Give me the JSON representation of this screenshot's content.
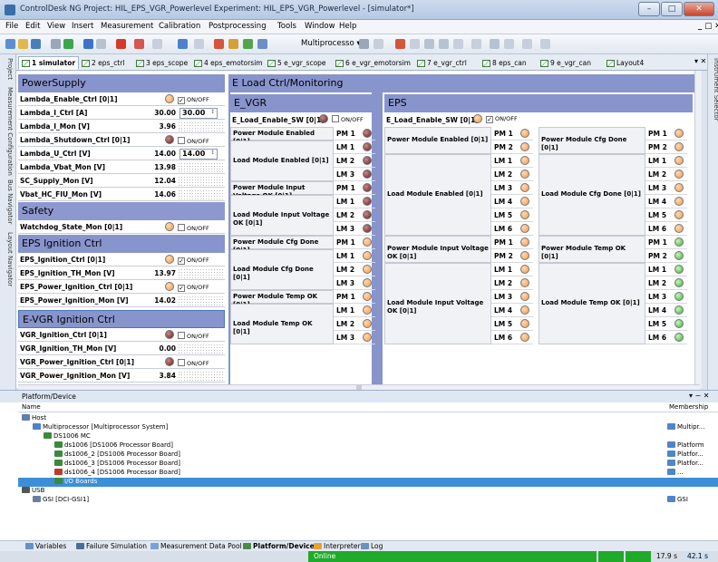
{
  "window": {
    "title": "ControlDesk NG  Project: HIL_EPS_VGR_Powerlevel  Experiment: HIL_EPS_VGR_Powerlevel - [simulator*]"
  },
  "menu": [
    "File",
    "Edit",
    "View",
    "Insert",
    "Measurement",
    "Calibration",
    "Postprocessing",
    "Tools",
    "Window",
    "Help"
  ],
  "toolbar": {
    "platform_dropdown": "Multiprocesso"
  },
  "tabs": [
    "1 simulator",
    "2 eps_ctrl",
    "3 eps_scope",
    "4 eps_emotorsim",
    "5 e_vgr_scope",
    "6 e_vgr_emotorsim",
    "7 e_vgr_ctrl",
    "8 eps_can",
    "9 e_vgr_can",
    "Layout4"
  ],
  "left_side_tabs": [
    "Project",
    "Measurement Configuration",
    "Bus Navigator",
    "Layout Navigator"
  ],
  "right_side_tabs": [
    "Instrument Selector"
  ],
  "powersupply": {
    "title": "PowerSupply",
    "rows": [
      {
        "label": "Lambda_Enable_Ctrl [0|1]",
        "lamp": "on",
        "check": "ON/OFF",
        "checked": "✓"
      },
      {
        "label": "Lambda_I_Ctrl [A]",
        "value": "30.00",
        "input": "30.00"
      },
      {
        "label": "Lambda_I_Mon [V]",
        "value": "3.96"
      },
      {
        "label": "Lambda_Shutdown_Ctrl [0|1]",
        "lamp": "off",
        "check": "ON/OFF",
        "checked": ""
      },
      {
        "label": "Lambda_U_Ctrl [V]",
        "value": "14.00",
        "input": "14.00"
      },
      {
        "label": "Lambda_Vbat_Mon [V]",
        "value": "13.98"
      },
      {
        "label": "SC_Supply_Mon [V]",
        "value": "12.04"
      },
      {
        "label": "Vbat_HC_FIU_Mon [V]",
        "value": "14.06"
      }
    ]
  },
  "safety": {
    "title": "Safety",
    "rows": [
      {
        "label": "Watchdog_State_Mon [0|1]",
        "lamp": "on",
        "check": "ON/OFF",
        "checked": ""
      }
    ]
  },
  "eps_ignition": {
    "title": "EPS Ignition Ctrl",
    "rows": [
      {
        "label": "EPS_Ignition_Ctrl [0|1]",
        "lamp": "on",
        "check": "ON/OFF",
        "checked": "✓"
      },
      {
        "label": "EPS_Ignition_TH_Mon [V]",
        "value": "13.97"
      },
      {
        "label": "EPS_Power_Ignition_Ctrl [0|1]",
        "lamp": "on",
        "check": "ON/OFF",
        "checked": "✓"
      },
      {
        "label": "EPS_Power_Ignition_Mon [V]",
        "value": "14.02"
      }
    ]
  },
  "evgr_ignition": {
    "title": "E-VGR Ignition Ctrl",
    "rows": [
      {
        "label": "VGR_Ignition_Ctrl [0|1]",
        "lamp": "off",
        "check": "ON/OFF",
        "checked": ""
      },
      {
        "label": "VGR_Ignition_TH_Mon [V]",
        "value": "0.00"
      },
      {
        "label": "VGR_Power_Ignition_Ctrl [0|1]",
        "lamp": "off",
        "check": "ON/OFF",
        "checked": ""
      },
      {
        "label": "VGR_Power_Ignition_Mon [V]",
        "value": "3.84"
      }
    ]
  },
  "eload": {
    "title": "E Load Ctrl/Monitoring"
  },
  "evgr": {
    "title": "E_VGR",
    "switch_label": "E_Load_Enable_SW [0|1]",
    "switch_check": "ON/OFF",
    "groups": [
      {
        "label": "Power Module Enabled [0|1]",
        "items": [
          "PM 1"
        ]
      },
      {
        "label": "Load Module Enabled [0|1]",
        "items": [
          "LM 1",
          "LM 2",
          "LM 3"
        ]
      },
      {
        "label": "Power Module Input Voltage OK [0|1]",
        "items": [
          "PM 1"
        ]
      },
      {
        "label": "Load Module Input Voltage OK [0|1]",
        "items": [
          "LM 1",
          "LM 2",
          "LM 3"
        ]
      },
      {
        "label": "Power Module Cfg Done [0|1]",
        "items": [
          "PM 1"
        ]
      },
      {
        "label": "Load Module Cfg Done [0|1]",
        "items": [
          "LM 1",
          "LM 2",
          "LM 3"
        ]
      },
      {
        "label": "Power Module Temp OK [0|1]",
        "items": [
          "PM 1"
        ]
      },
      {
        "label": "Load Module Temp OK [0|1]",
        "items": [
          "LM 1",
          "LM 2",
          "LM 3"
        ]
      }
    ]
  },
  "eps": {
    "title": "EPS",
    "switch_label": "E_Load_Enable_SW [0|1]",
    "switch_check": "ON/OFF",
    "groups_left": [
      {
        "label": "Power Module Enabled [0|1]",
        "items": [
          "PM 1",
          "PM 2"
        ]
      },
      {
        "label": "Load Module Enabled [0|1]",
        "items": [
          "LM 1",
          "LM 2",
          "LM 3",
          "LM 4",
          "LM 5",
          "LM 6"
        ]
      },
      {
        "label": "Power Module Input Voltage OK [0|1]",
        "items": [
          "PM 1",
          "PM 2"
        ]
      },
      {
        "label": "Load Module Input Voltage OK [0|1]",
        "items": [
          "LM 1",
          "LM 2",
          "LM 3",
          "LM 4",
          "LM 5",
          "LM 6"
        ]
      }
    ],
    "groups_right": [
      {
        "label": "Power Module Cfg Done [0|1]",
        "items": [
          "PM 1",
          "PM 2"
        ]
      },
      {
        "label": "Load Module Cfg Done [0|1]",
        "items": [
          "LM 1",
          "LM 2",
          "LM 3",
          "LM 4",
          "LM 5",
          "LM 6"
        ]
      },
      {
        "label": "Power Module Temp OK [0|1]",
        "items": [
          "PM 1",
          "PM 2"
        ]
      },
      {
        "label": "Load Module Temp OK [0|1]",
        "items": [
          "LM 1",
          "LM 2",
          "LM 3",
          "LM 4",
          "LM 5",
          "LM 6"
        ]
      }
    ]
  },
  "platform": {
    "title": "Platform/Device",
    "col_name": "Name",
    "col_membership": "Membership",
    "tree": [
      {
        "label": "Host",
        "member": "",
        "depth": 0,
        "icon": "host-icon"
      },
      {
        "label": "Multiprocessor [Multiprocessor System]",
        "member": "Multipr...",
        "depth": 1,
        "icon": "multiprocessor-icon"
      },
      {
        "label": "DS1006 MC",
        "member": "",
        "depth": 2,
        "icon": "board-icon"
      },
      {
        "label": "ds1006 [DS1006 Processor Board]",
        "member": "Platform",
        "depth": 3,
        "icon": "board-icon"
      },
      {
        "label": "ds1006_2 [DS1006 Processor Board]",
        "member": "Platfor...",
        "depth": 3,
        "icon": "board-icon"
      },
      {
        "label": "ds1006_3 [DS1006 Processor Board]",
        "member": "Platfor...",
        "depth": 3,
        "icon": "board-icon"
      },
      {
        "label": "ds1006_4 [DS1006 Processor Board]",
        "member": "...",
        "depth": 3,
        "icon": "board-error-icon"
      },
      {
        "label": "I/O Boards",
        "member": "",
        "depth": 3,
        "icon": "io-board-icon",
        "selected": true
      },
      {
        "label": "USB",
        "member": "",
        "depth": 0,
        "icon": "usb-icon"
      },
      {
        "label": "GSI [DCI-GSI1]",
        "member": "GSI",
        "depth": 1,
        "icon": "gsi-icon"
      }
    ]
  },
  "bottom_tabs": [
    "Variables",
    "Failure Simulation",
    "Measurement Data Pool",
    "Platform/Device",
    "Interpreter",
    "Log"
  ],
  "status": {
    "online": "Online",
    "time1": "17.9 s",
    "time2": "42.1 s"
  },
  "colors": {
    "section_header": "#8894cc",
    "lamp_on": "#f39a4a",
    "lamp_off": "#5a2320",
    "lamp_green": "#3bb535",
    "online": "#1faa2a"
  }
}
